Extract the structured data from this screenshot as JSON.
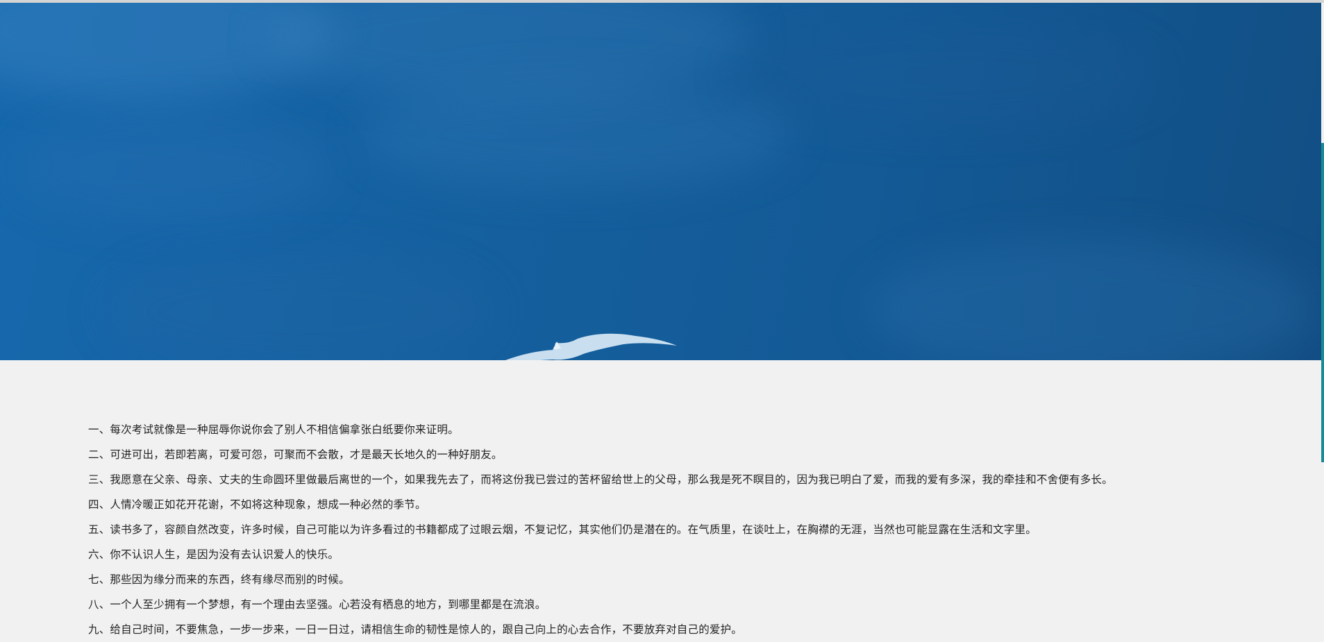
{
  "colors": {
    "banner_sky": "#15609f",
    "page_background": "#f1f1f1",
    "text": "#222222",
    "scrollbar_thumb": "#1a8a96"
  },
  "banner": {
    "image": "blue-sky-with-flying-seagull"
  },
  "quotes": [
    "一、每次考试就像是一种屈辱你说你会了别人不相信偏拿张白纸要你来证明。",
    "二、可进可出，若即若离，可爱可怨，可聚而不会散，才是最天长地久的一种好朋友。",
    "三、我愿意在父亲、母亲、丈夫的生命圆环里做最后离世的一个，如果我先去了，而将这份我已尝过的苦杯留给世上的父母，那么我是死不瞑目的，因为我已明白了爱，而我的爱有多深，我的牵挂和不舍便有多长。",
    "四、人情冷暖正如花开花谢，不如将这种现象，想成一种必然的季节。",
    "五、读书多了，容颜自然改变，许多时候，自己可能以为许多看过的书籍都成了过眼云烟，不复记忆，其实他们仍是潜在的。在气质里，在谈吐上，在胸襟的无涯，当然也可能显露在生活和文字里。",
    "六、你不认识人生，是因为没有去认识爱人的快乐。",
    "七、那些因为缘分而来的东西，终有缘尽而别的时候。",
    "八、一个人至少拥有一个梦想，有一个理由去坚强。心若没有栖息的地方，到哪里都是在流浪。",
    "九、给自己时间，不要焦急，一步一步来，一日一日过，请相信生命的韧性是惊人的，跟自己向上的心去合作，不要放弃对自己的爱护。"
  ]
}
